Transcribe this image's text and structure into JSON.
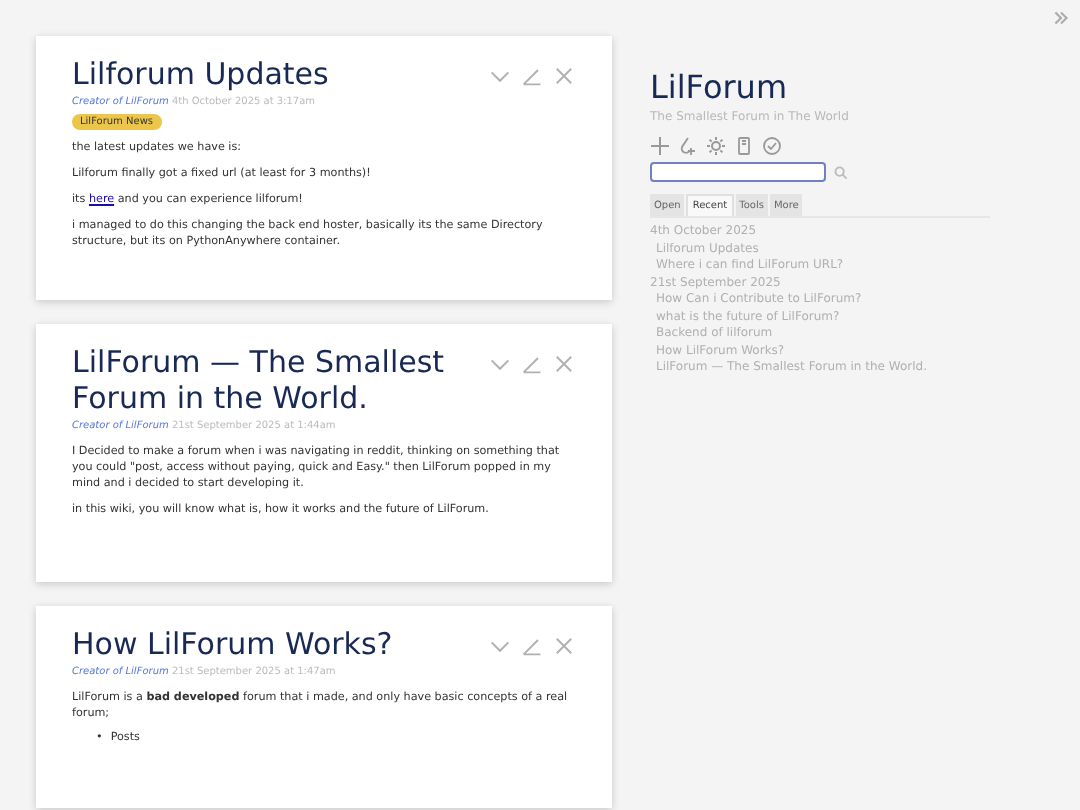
{
  "tiddlers": [
    {
      "title": "Lilforum Updates",
      "creator": "Creator of LilForum",
      "date": "4th October 2025 at 3:17am",
      "tags": [
        {
          "label": "LilForum News",
          "color": "#ecc64a"
        }
      ],
      "blocks": [
        {
          "kind": "para",
          "parts": [
            {
              "kind": "text",
              "text": "the latest updates we have is:"
            }
          ]
        },
        {
          "kind": "para",
          "parts": [
            {
              "kind": "text",
              "text": "Lilforum finally got a fixed url (at least for 3 months)!"
            }
          ]
        },
        {
          "kind": "para",
          "parts": [
            {
              "kind": "text",
              "text": "its "
            },
            {
              "kind": "link",
              "text": "here"
            },
            {
              "kind": "text",
              "text": " and you can experience lilforum!"
            }
          ]
        },
        {
          "kind": "para",
          "parts": [
            {
              "kind": "text",
              "text": "i managed to do this changing the back end hoster, basically its the same Directory structure, but its on PythonAnywhere container."
            }
          ]
        }
      ]
    },
    {
      "title": "LilForum — The Smallest Forum in the World.",
      "creator": "Creator of LilForum",
      "date": "21st September 2025 at 1:44am",
      "blocks": [
        {
          "kind": "para",
          "parts": [
            {
              "kind": "text",
              "text": "I Decided to make a forum when i was navigating in reddit, thinking on something that you could \"post, access without paying, quick and Easy.\" then LilForum popped in my mind and i decided to start developing it."
            }
          ]
        },
        {
          "kind": "para",
          "parts": [
            {
              "kind": "text",
              "text": "in this wiki, you will know what is, how it works and the future of LilForum."
            }
          ]
        }
      ]
    },
    {
      "title": "How LilForum Works?",
      "creator": "Creator of LilForum",
      "date": "21st September 2025 at 1:47am",
      "blocks": [
        {
          "kind": "para",
          "parts": [
            {
              "kind": "text",
              "text": "LilForum is a **bad developed** forum that i made, and only have basic concepts of a real forum;"
            }
          ]
        },
        {
          "kind": "list",
          "items": [
            {
              "bullet": "•",
              "text": "Posts"
            }
          ]
        }
      ]
    }
  ],
  "sidebar": {
    "title": "LilForum",
    "subtitle": "The Smallest Forum in The World",
    "tabs": [
      {
        "label": "Open",
        "selected": false
      },
      {
        "label": "Recent",
        "selected": true
      },
      {
        "label": "Tools",
        "selected": false
      },
      {
        "label": "More",
        "selected": false
      }
    ],
    "recent": [
      {
        "date": "4th October 2025",
        "items": [
          "Lilforum Updates",
          "Where i can find LilForum URL?"
        ]
      },
      {
        "date": "21st September 2025",
        "items": [
          "How Can i Contribute to LilForum?",
          "what is the future of LilForum?",
          "Backend of lilforum",
          "How LilForum Works?",
          "LilForum — The Smallest Forum in the World."
        ]
      }
    ]
  }
}
